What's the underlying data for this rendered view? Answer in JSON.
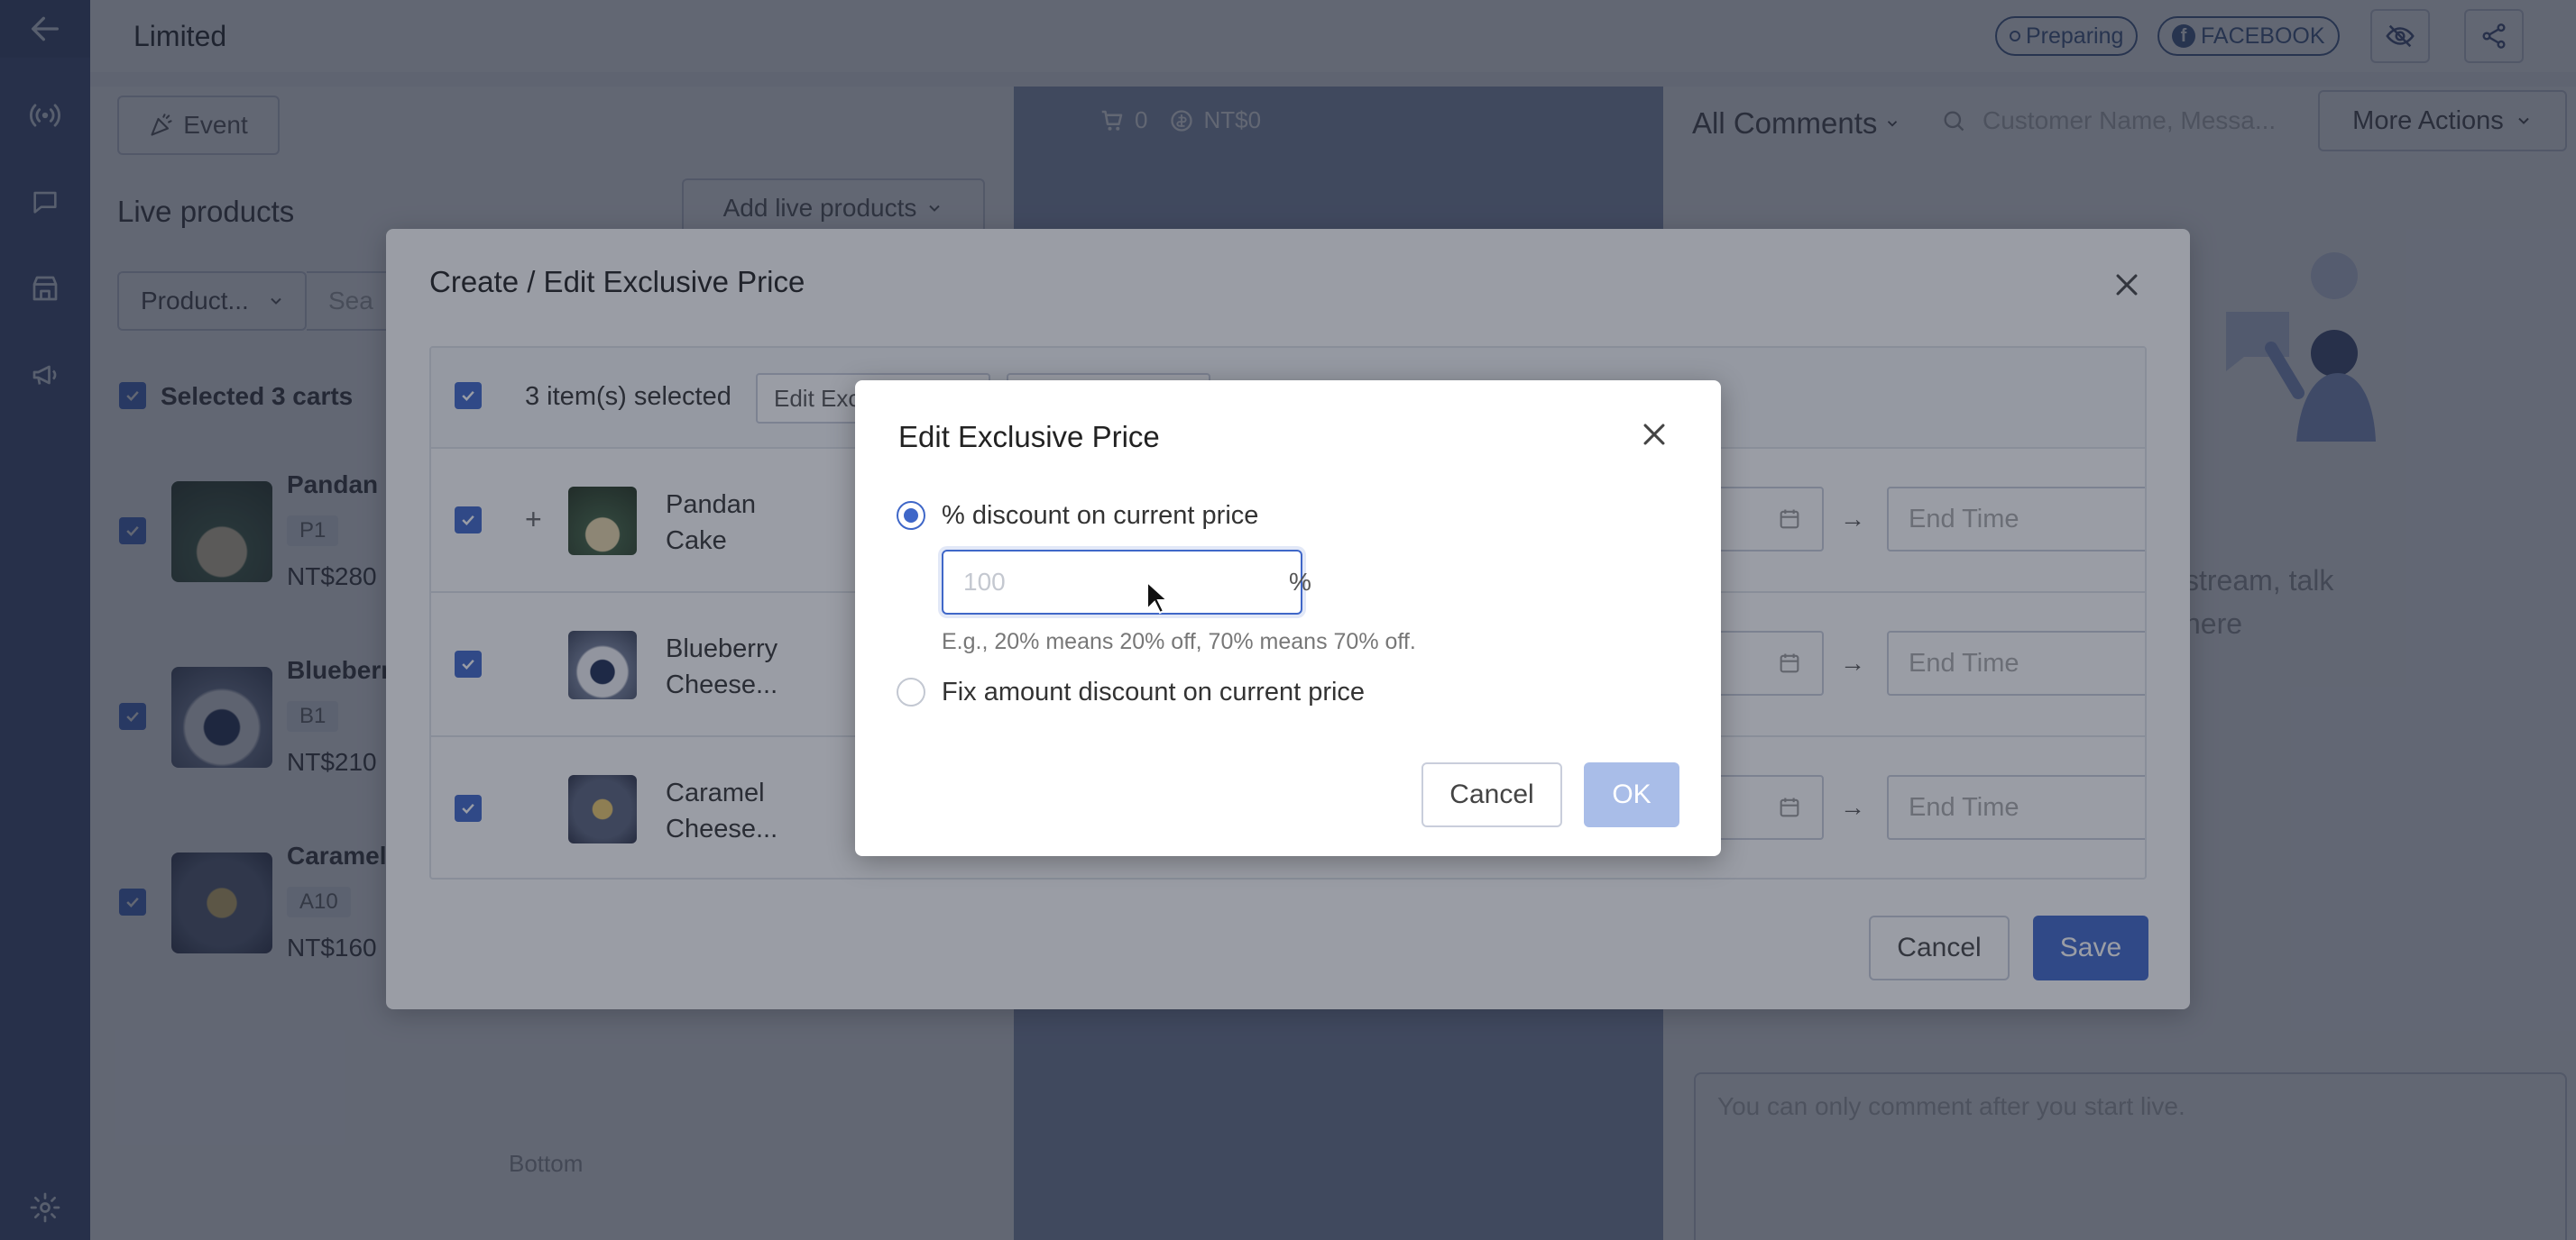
{
  "header": {
    "title": "Limited",
    "status_badge": "Preparing",
    "platform_badge": "FACEBOOK"
  },
  "left_panel": {
    "event_button": "Event",
    "heading": "Live products",
    "add_button": "Add live products",
    "product_dropdown": "Product...",
    "search_placeholder": "Sea",
    "selected_label": "Selected 3 carts",
    "products": [
      {
        "name": "Pandan",
        "code": "P1",
        "price": "NT$280"
      },
      {
        "name": "Blueberr",
        "code": "B1",
        "price": "NT$210"
      },
      {
        "name": "Caramel",
        "code": "A10",
        "price": "NT$160"
      }
    ],
    "bottom_label": "Bottom"
  },
  "stream": {
    "cart_count": "0",
    "total": "NT$0"
  },
  "right_panel": {
    "comments_filter": "All Comments",
    "search_placeholder": "Customer Name, Messa...",
    "more_actions": "More Actions",
    "empty_line1": "stream, talk",
    "empty_line2": "here",
    "comment_placeholder": "You can only comment after you start live."
  },
  "outer_modal": {
    "title": "Create / Edit Exclusive Price",
    "selected_label": "3 item(s) selected",
    "edit_button": "Edit Exc",
    "rows": [
      {
        "name_line1": "Pandan",
        "name_line2": "Cake",
        "end_placeholder": "End Time"
      },
      {
        "name_line1": "Blueberry",
        "name_line2": "Cheese...",
        "end_placeholder": "End Time"
      },
      {
        "name_line1": "Caramel",
        "name_line2": "Cheese...",
        "end_placeholder": "End Time"
      }
    ],
    "cancel": "Cancel",
    "save": "Save"
  },
  "inner_modal": {
    "title": "Edit Exclusive Price",
    "option_percent": "% discount on current price",
    "percent_placeholder": "100",
    "percent_suffix": "%",
    "hint": "E.g., 20% means 20% off, 70% means 70% off.",
    "option_fixed": "Fix amount discount on current price",
    "cancel": "Cancel",
    "ok": "OK"
  },
  "colors": {
    "primary": "#3f67c8",
    "primary_disabled": "#a9bde8",
    "sidebar": "#3b4b75",
    "stream_bg": "#8f9bba"
  }
}
